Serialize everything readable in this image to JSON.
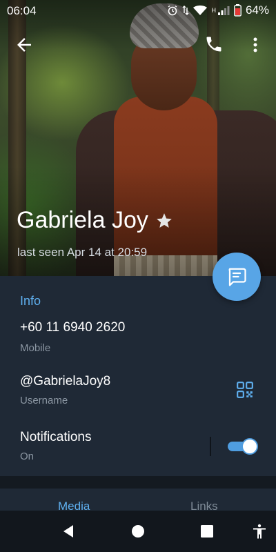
{
  "status_bar": {
    "time": "06:04",
    "battery": "64%",
    "network_label": "H"
  },
  "header": {
    "back_icon": "arrow-left-icon",
    "call_icon": "phone-icon",
    "more_icon": "more-vertical-icon"
  },
  "profile": {
    "name": "Gabriela Joy",
    "last_seen": "last seen Apr 14 at 20:59",
    "badge_icon": "star-icon"
  },
  "info": {
    "section_title": "Info",
    "phone": "+60 11 6940 2620",
    "phone_label": "Mobile",
    "username": "@GabrielaJoy8",
    "username_label": "Username",
    "notifications": "Notifications",
    "notifications_state": "On",
    "notifications_enabled": true
  },
  "tabs": [
    "Media",
    "Links"
  ],
  "colors": {
    "accent": "#5fb0f0",
    "panel": "#1f2936",
    "fab": "#58a5e6"
  }
}
